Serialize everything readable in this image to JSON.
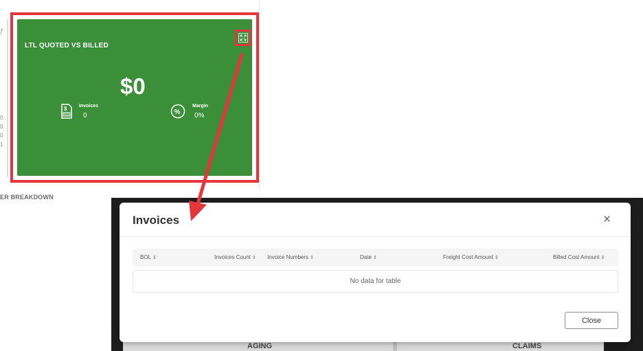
{
  "background": {
    "left_label": "ER BREAKDOWN",
    "top_mark": "ƒ",
    "side_marks": [
      "0",
      "0",
      "0",
      "1"
    ],
    "bottom_left": "AGING",
    "bottom_right": "CLAIMS"
  },
  "card": {
    "title": "LTL QUOTED VS BILLED",
    "value": "$0",
    "invoices_label": "Invoices",
    "invoices_value": "0",
    "margin_label": "Margin",
    "margin_value": "0%",
    "expand_icon": "expand-icon",
    "color": "#3b8f38",
    "highlight_color": "#e5363d"
  },
  "modal": {
    "title": "Invoices",
    "close_icon": "×",
    "columns": [
      "BOL",
      "Invoices Count",
      "Invoice Numbers",
      "Date",
      "Freight Cost Amount",
      "Billed Cost Amount"
    ],
    "sort_glyph": "⇕",
    "empty_text": "No data for table",
    "close_label": "Close"
  }
}
